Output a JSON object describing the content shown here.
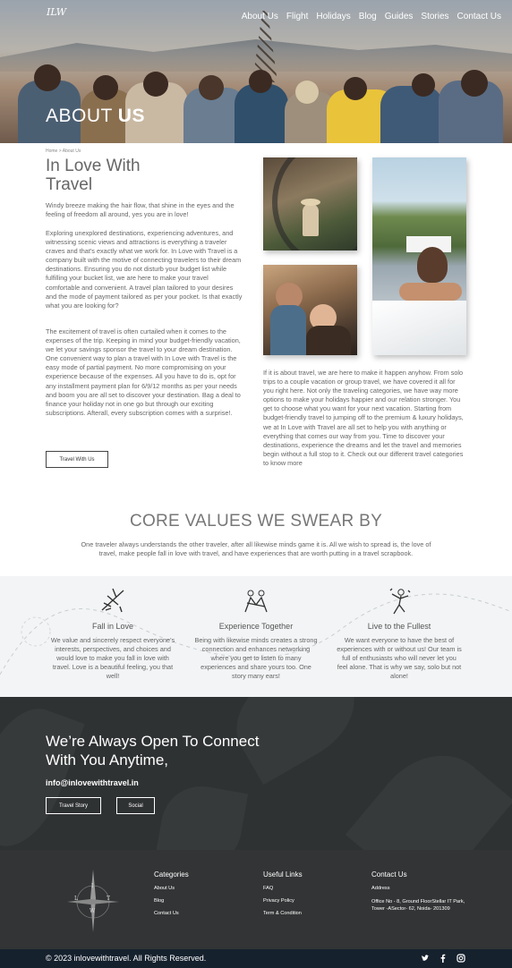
{
  "nav": {
    "logo": "ILW",
    "items": [
      "About Us",
      "Flight",
      "Holidays",
      "Blog",
      "Guides",
      "Stories",
      "Contact Us"
    ]
  },
  "hero": {
    "title_light": "ABOUT ",
    "title_bold": "US"
  },
  "about": {
    "breadcrumb": "Home > About Us",
    "heading": "In Love With Travel",
    "p1": "Windy breeze making the hair flow, that shine in the eyes and the feeling of freedom all around, yes you are in love!",
    "p2": "Exploring unexplored destinations, experiencing adventures, and witnessing scenic views and attractions is everything a traveler craves and that's exactly what we work for. In Love with Travel is a company built with the motive of connecting travelers to their dream destinations. Ensuring you do not disturb your budget list while fulfilling your bucket list, we are here to make your travel comfortable and convenient. A travel plan tailored to your desires and the mode of payment tailored as per your pocket. Is that exactly what you are looking for?",
    "p3": "The excitement of travel is often curtailed when it comes to the expenses of the trip. Keeping in mind your budget-friendly vacation, we let your savings sponsor the travel to your dream destination. One convenient way to plan a travel with In Love with Travel is the easy mode of partial payment. No more compromising on your experience because of the expenses. All you have to do is, opt for any installment payment plan for 6/9/12 months as per your needs and boom you are all set to discover your destination. Bag a deal to finance your holiday not in one go but through our exciting subscriptions. Afterall, every subscription comes with a surprise!.",
    "button": "Travel With Us",
    "right_text": "If it is about travel, we are here to make it happen anyhow. From solo trips to a couple vacation or group travel, we have covered it all for you right here. Not only the traveling categories, we have way more options to make your holidays happier and our relation stronger. You get to choose what you want for your next vacation. Starting from budget-friendly travel to jumping off to the premium & luxury holidays, we at In Love with Travel are all set to help you with anything or everything that comes our way from you. Time to discover your destinations, experience the dreams and let the travel and memories begin without a full stop to it. Check out our different travel categories to know more"
  },
  "core": {
    "heading": "CORE VALUES WE SWEAR BY",
    "text": "One traveler always understands the other traveler, after all likewise minds game it is. All we wish to spread is, the love of travel, make people fall in love with travel, and have experiences that are worth putting in a travel scrapbook.",
    "values": [
      {
        "title": "Fall in Love",
        "icon": "airplane-icon",
        "text": "We value and sincerely respect everyone's interests, perspectives, and choices and would love to make you fall in love with travel. Love is a beautiful feeling, you that well!"
      },
      {
        "title": "Experience Together",
        "icon": "people-together-icon",
        "text": "Being with likewise minds creates a strong connection and enhances networking where you get to listen to many experiences and share yours too. One story many ears!"
      },
      {
        "title": "Live to the Fullest",
        "icon": "dancing-person-icon",
        "text": "We want everyone to have the best of experiences with or without us! Our team is full of enthusiasts who will never let you feel alone. That is why we say, solo but not alone!"
      }
    ]
  },
  "contact_band": {
    "heading": "We’re Always Open To Connect With You Anytime,",
    "email": "info@inlovewithtravel.in",
    "buttons": [
      "Travel Story",
      "Social"
    ]
  },
  "footer": {
    "categories": {
      "title": "Categories",
      "items": [
        "About Us",
        "Blog",
        "Contact Us"
      ]
    },
    "useful": {
      "title": "Useful Links",
      "items": [
        "FAQ",
        "Privacy Policy",
        "Term & Condition"
      ]
    },
    "contact": {
      "title": "Contact Us",
      "label": "Address",
      "address": "Office No - 8, Ground FloorStellar IT Park, Tower -ASector- 62, Noida- 201309"
    },
    "copyright": "© 2023 inlovewithtravel. All Rights Reserved.",
    "social": [
      "twitter-icon",
      "facebook-icon",
      "instagram-icon"
    ]
  }
}
